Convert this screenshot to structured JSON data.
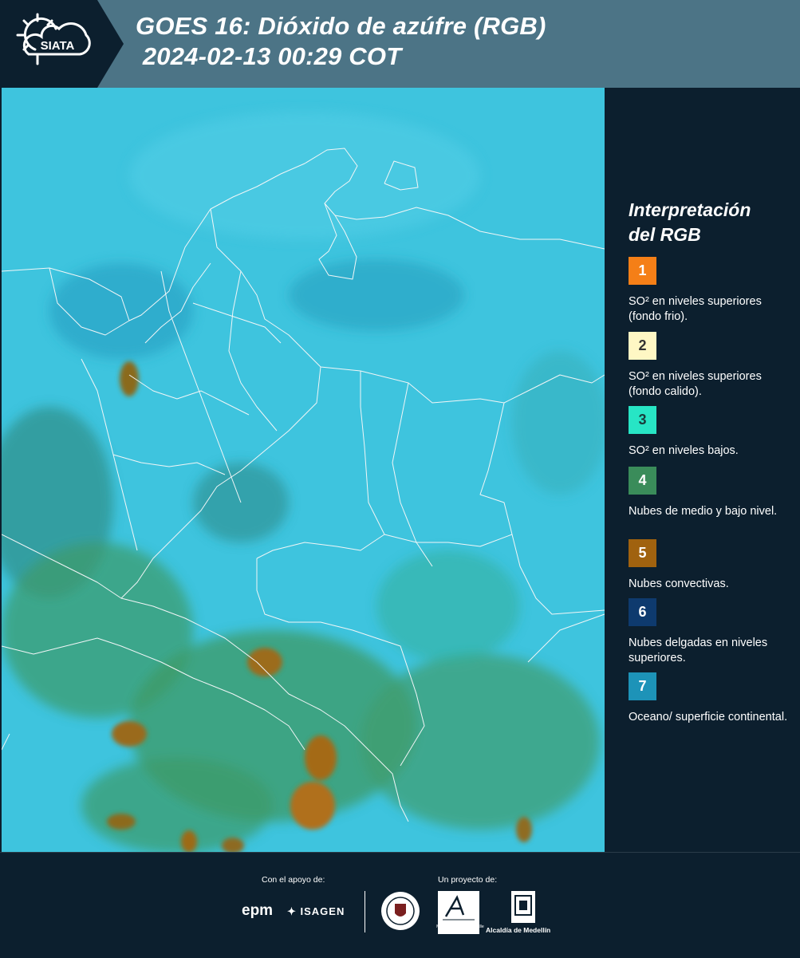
{
  "header": {
    "brand": "SIATA",
    "title_line1": "GOES 16: Dióxido de azúfre (RGB)",
    "title_line2": " 2024-02-13 00:29 COT"
  },
  "legend": {
    "title_line1": "Interpretación",
    "title_line2": "del RGB",
    "items": [
      {
        "number": "1",
        "color": "#f57f17",
        "text_color": "#ffffff",
        "label": "SO² en niveles superiores (fondo frio)."
      },
      {
        "number": "2",
        "color": "#fff7c4",
        "text_color": "#333333",
        "label": "SO² en niveles superiores (fondo calido)."
      },
      {
        "number": "3",
        "color": "#27e5c5",
        "text_color": "#1a3b3b",
        "label": "SO² en niveles bajos."
      },
      {
        "number": "4",
        "color": "#3a8c5a",
        "text_color": "#ffffff",
        "label": "Nubes de medio y bajo nivel."
      },
      {
        "number": "5",
        "color": "#a0620f",
        "text_color": "#ffffff",
        "label": "Nubes convectivas."
      },
      {
        "number": "6",
        "color": "#0e3a6e",
        "text_color": "#ffffff",
        "label": "Nubes delgadas en niveles superiores."
      },
      {
        "number": "7",
        "color": "#1d93b8",
        "text_color": "#ffffff",
        "label": "Oceano/ superficie continental."
      }
    ]
  },
  "footer": {
    "support_label": "Con el apoyo de:",
    "project_label": "Un proyecto de:",
    "sponsors": [
      "epm",
      "ISAGEN"
    ],
    "partners": [
      "Área Metropolitana Valle de Aburrá",
      "Alcaldía de Medellín"
    ],
    "area_caption": "METROPOLITANA Valle de Aburrá",
    "alcaldia_caption": "Alcaldía de Medellín"
  }
}
